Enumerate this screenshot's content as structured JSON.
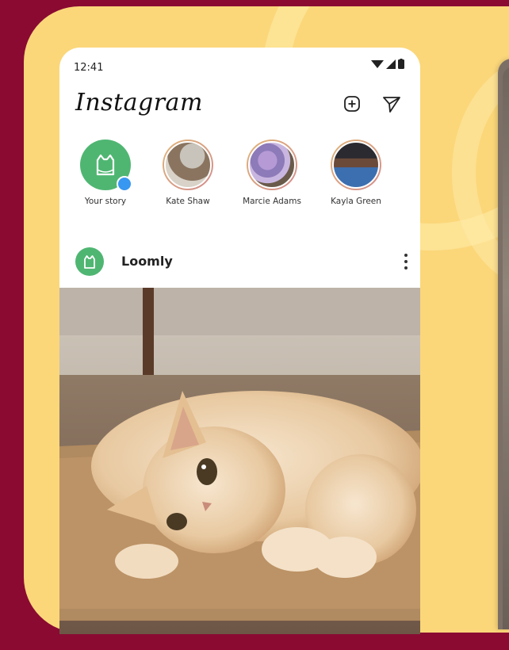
{
  "status_bar": {
    "time": "12:41"
  },
  "header": {
    "app_name": "Instagram"
  },
  "stories": [
    {
      "label": "Your story"
    },
    {
      "label": "Kate Shaw"
    },
    {
      "label": "Marcie Adams"
    },
    {
      "label": "Kayla Green"
    }
  ],
  "post": {
    "account_name": "Loomly"
  },
  "colors": {
    "backdrop": "#8a0a32",
    "card": "#fbd77a",
    "brand_green": "#4fb672",
    "add_story_badge": "#3897f0"
  }
}
